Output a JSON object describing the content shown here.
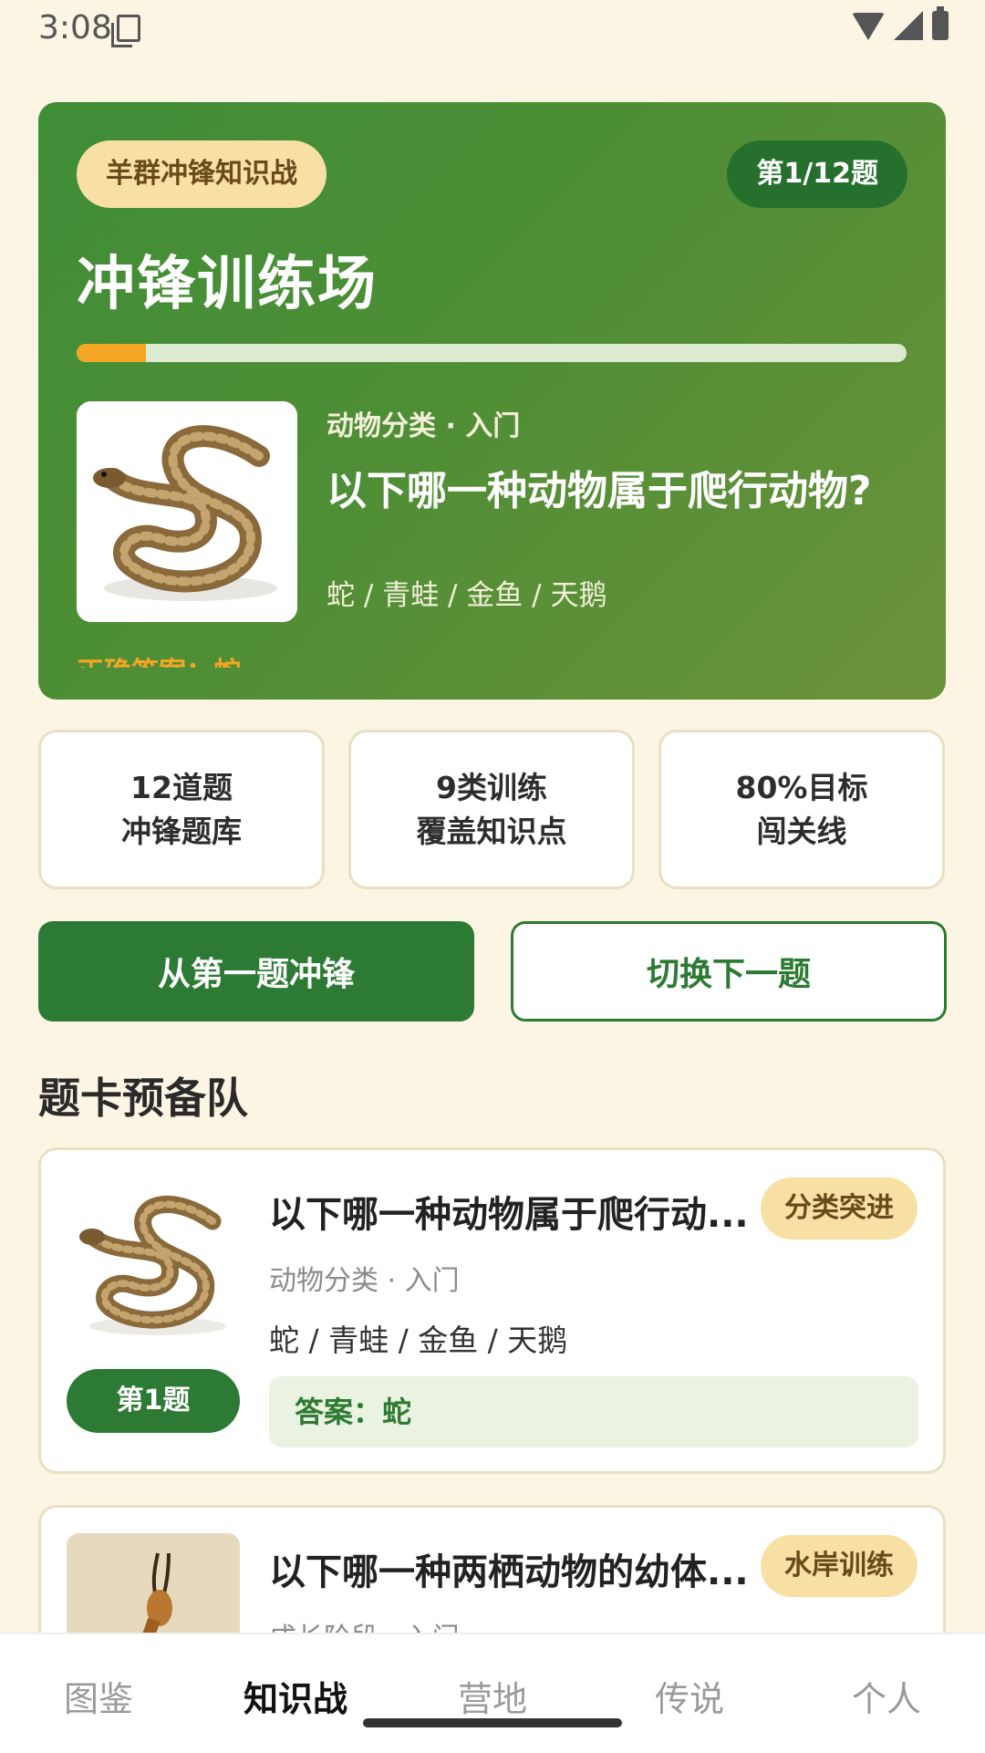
{
  "status": {
    "time": "3:08"
  },
  "hero": {
    "event_chip": "羊群冲锋知识战",
    "progress_chip": "第1/12题",
    "title": "冲锋训练场",
    "progress_fraction": 0.0833,
    "category": "动物分类 · 入门",
    "question": "以下哪一种动物属于爬行动物?",
    "options": "蛇  /  青蛙  /  金鱼  /  天鹅",
    "answer_hint": "正确答案：蛇"
  },
  "stats": [
    {
      "line1": "12道题",
      "line2": "冲锋题库"
    },
    {
      "line1": "9类训练",
      "line2": "覆盖知识点"
    },
    {
      "line1": "80%目标",
      "line2": "闯关线"
    }
  ],
  "buttons": {
    "primary": "从第一题冲锋",
    "secondary": "切换下一题"
  },
  "section_title": "题卡预备队",
  "cards": [
    {
      "title": "以下哪一种动物属于爬行动...",
      "tag": "分类突进",
      "category": "动物分类 · 入门",
      "options": "蛇 / 青蛙 / 金鱼 / 天鹅",
      "number": "第1题",
      "answer": "答案：蛇"
    },
    {
      "title": "以下哪一种两栖动物的幼体...",
      "tag": "水岸训练",
      "category": "成长阶段 · 入门"
    }
  ],
  "nav": {
    "items": [
      "图鉴",
      "知识战",
      "营地",
      "传说",
      "个人"
    ],
    "active": "知识战"
  },
  "colors": {
    "primary": "#2C7A33",
    "accent": "#F2A623",
    "tag": "#F8DFA3",
    "background": "#FDF5E4"
  }
}
